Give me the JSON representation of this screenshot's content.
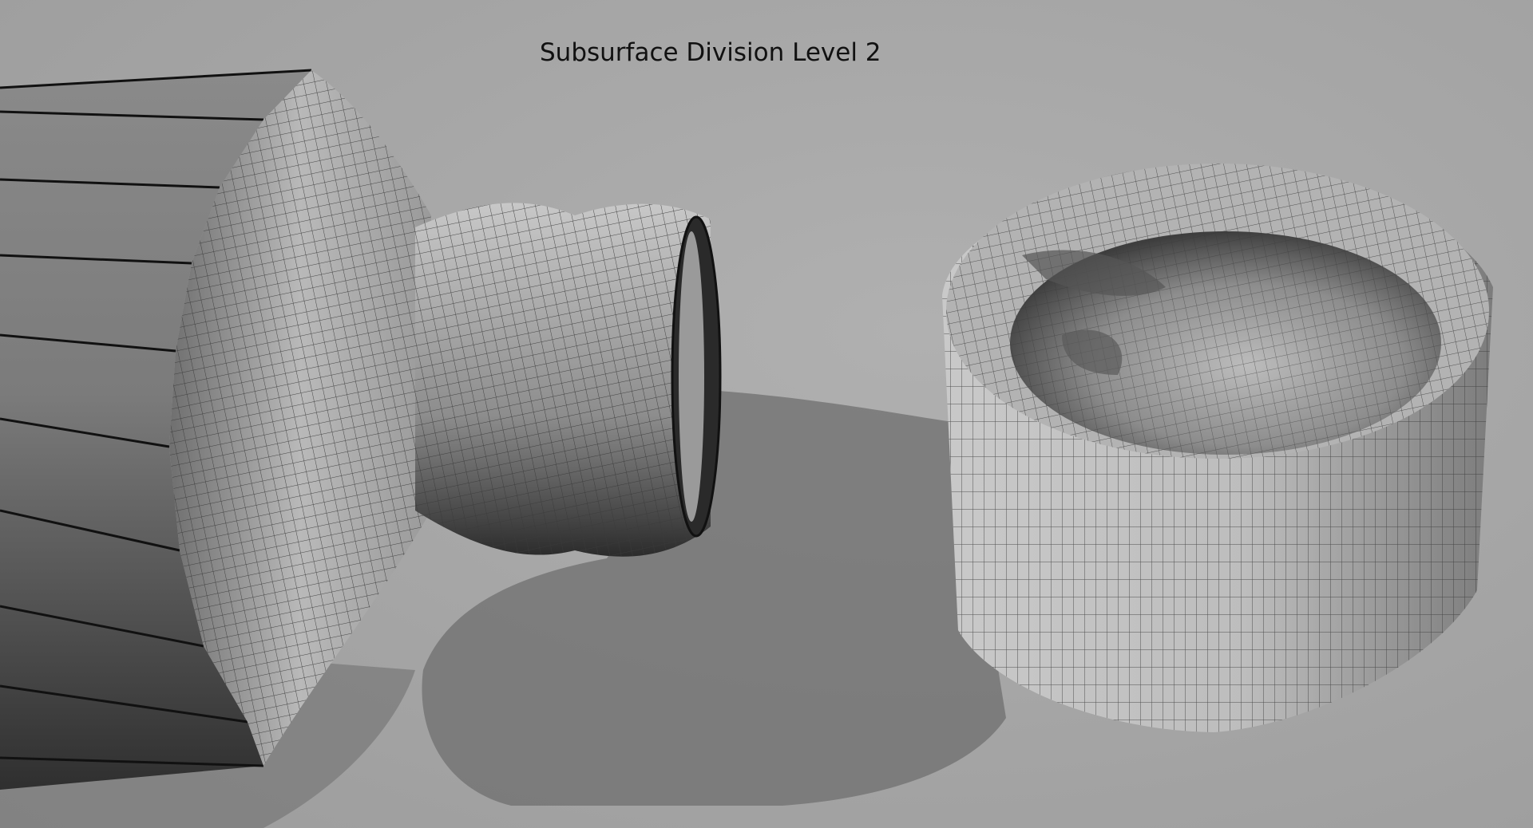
{
  "caption": "Subsurface Division Level 2",
  "objects": [
    "bottle-wireframe",
    "cap-wireframe",
    "ground-shadow"
  ]
}
